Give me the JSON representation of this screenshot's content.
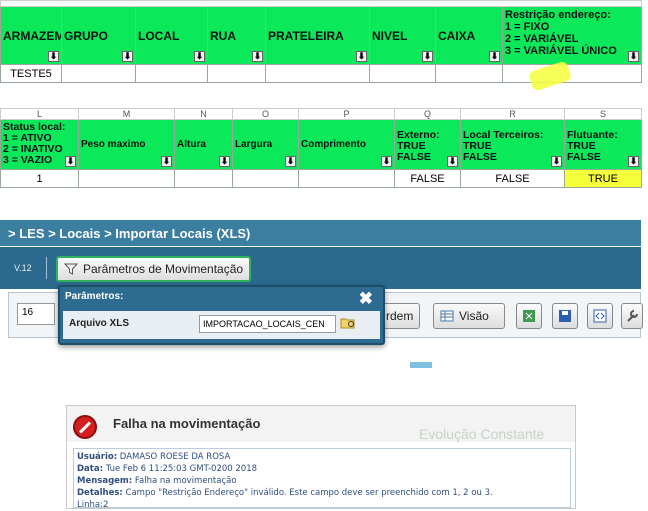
{
  "sheet1": {
    "headers": [
      "ARMAZEM",
      "GRUPO",
      "LOCAL",
      "RUA",
      "PRATELEIRA",
      "NIVEL",
      "CAIXA",
      "Restrição endereço:\n1 = FIXO\n2 = VARIÁVEL\n3 = VARIÁVEL ÚNICO"
    ],
    "row": [
      "TESTE5",
      "",
      "",
      "",
      "",
      "",
      "",
      ""
    ]
  },
  "sheet2": {
    "letters": [
      "L",
      "M",
      "N",
      "O",
      "P",
      "Q",
      "R",
      "S"
    ],
    "headers": [
      "Status local:\n1 = ATIVO\n2 = INATIVO\n3 = VAZIO",
      "Peso maximo",
      "Altura",
      "Largura",
      "Comprimento",
      "Externo:\nTRUE\nFALSE",
      "Local Terceiros:\nTRUE\nFALSE",
      "Flutuante:\nTRUE\nFALSE"
    ],
    "row": [
      "1",
      "",
      "",
      "",
      "",
      "FALSE",
      "FALSE",
      "TRUE"
    ]
  },
  "highlight_color": "#f5ff3a",
  "app": {
    "breadcrumb": "> LES > Locais > Importar Locais (XLS)",
    "version": "V.12",
    "params_button": "Parâmetros de Movimentação",
    "page_value": "16",
    "ordem_label": "rdem",
    "visao_label": "Visão",
    "popup_title": "Parâmetros:",
    "popup_close": "✖",
    "file_label": "Arquivo XLS",
    "file_value": "IMPORTACAO_LOCAIS_CEN"
  },
  "error": {
    "title": "Falha na movimentação",
    "watermark": "Evolução Constante",
    "lines": [
      {
        "k": "Usuário:",
        "v": " DAMASO ROESE DA ROSA"
      },
      {
        "k": "Data:",
        "v": " Tue Feb 6 11:25:03 GMT-0200 2018"
      },
      {
        "k": "Mensagem:",
        "v": " Falha na movimentação"
      },
      {
        "k": "Detalhes:",
        "v": " Campo \"Restrição Endereço\" inválido. Este campo deve ser preenchido com 1, 2 ou 3."
      },
      {
        "k": "",
        "v": " Linha:2"
      }
    ]
  }
}
